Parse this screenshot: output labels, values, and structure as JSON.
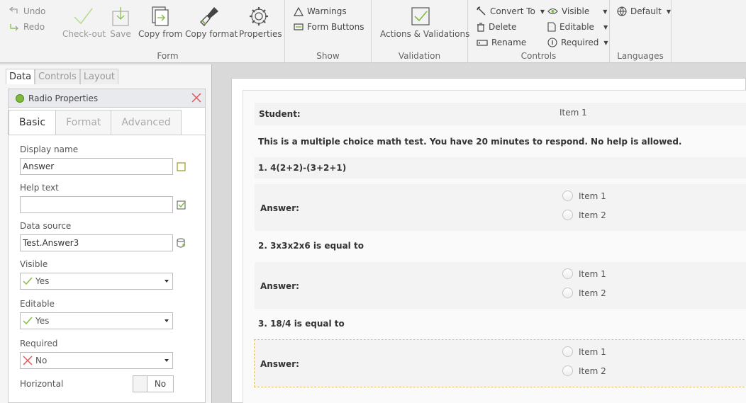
{
  "ribbon": {
    "history": {
      "undo": "Undo",
      "redo": "Redo"
    },
    "form": {
      "group_label": "Form",
      "checkout": "Check-out",
      "save": "Save",
      "copy_from": "Copy from",
      "copy_format": "Copy format",
      "properties": "Properties"
    },
    "show": {
      "group_label": "Show",
      "warnings": "Warnings",
      "form_buttons": "Form Buttons"
    },
    "validation": {
      "group_label": "Validation",
      "actions": "Actions & Validations"
    },
    "controls": {
      "group_label": "Controls",
      "convert_to": "Convert To",
      "delete": "Delete",
      "rename": "Rename",
      "visible": "Visible",
      "editable": "Editable",
      "required": "Required"
    },
    "languages": {
      "group_label": "Languages",
      "default": "Default"
    }
  },
  "leftpanel": {
    "tabs": [
      "Data",
      "Controls",
      "Layout"
    ],
    "properties": {
      "title": "Radio Properties",
      "tabs": [
        "Basic",
        "Format",
        "Advanced"
      ],
      "display_name_label": "Display name",
      "display_name_value": "Answer",
      "help_text_label": "Help text",
      "help_text_value": "",
      "data_source_label": "Data source",
      "data_source_value": "Test.Answer3",
      "visible_label": "Visible",
      "visible_value": "Yes",
      "editable_label": "Editable",
      "editable_value": "Yes",
      "required_label": "Required",
      "required_value": "No",
      "horizontal_label": "Horizontal",
      "horizontal_value": "No"
    }
  },
  "form": {
    "student_label": "Student:",
    "student_value": "Item 1",
    "intro": "This is a multiple choice math test. You have 20 minutes to respond. No help is allowed.",
    "questions": [
      {
        "question": "1. 4(2+2)-(3+2+1)",
        "answer_label": "Answer:",
        "options": [
          "Item 1",
          "Item 2"
        ]
      },
      {
        "question": "2. 3x3x2x6 is equal to",
        "answer_label": "Answer:",
        "options": [
          "Item 1",
          "Item 2"
        ]
      },
      {
        "question": "3. 18/4 is equal to",
        "answer_label": "Answer:",
        "options": [
          "Item 1",
          "Item 2"
        ]
      }
    ]
  },
  "colors": {
    "accent_green": "#7fba3a",
    "close_red": "#e05050",
    "selection_outline": "#e0c46c"
  }
}
